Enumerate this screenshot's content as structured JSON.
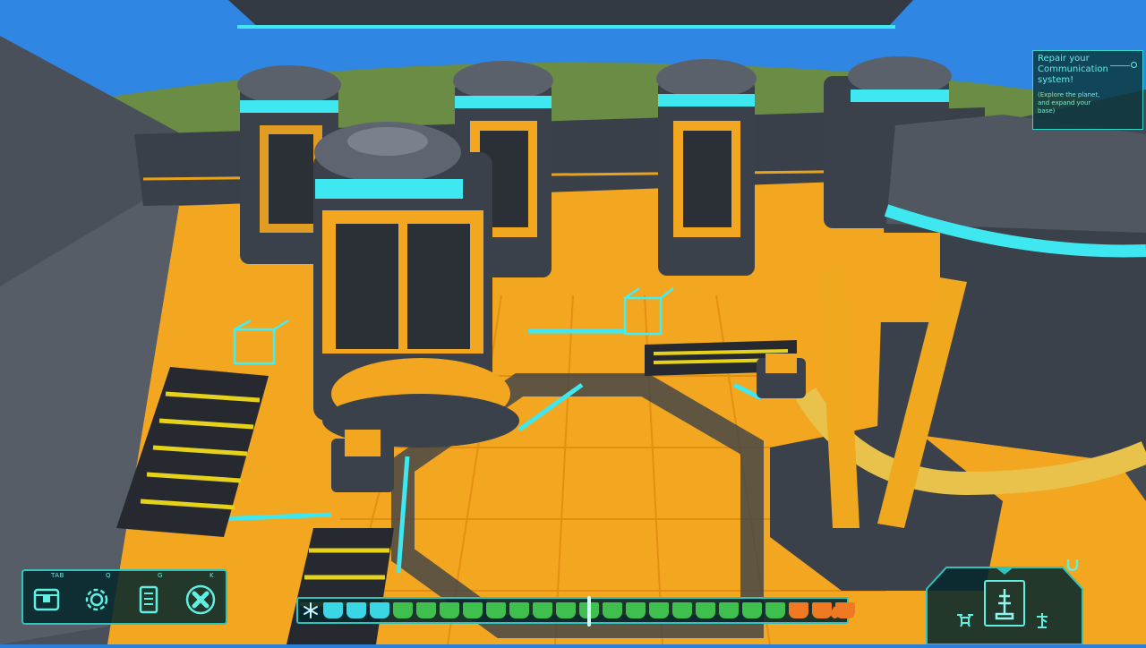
{
  "quest": {
    "title": "Repair your\nCommunication\nsystem!",
    "description": "(Explore the planet,\nand expand your\nbase)"
  },
  "menu": {
    "items": [
      {
        "key": "TAB",
        "icon": "storage-crate-icon"
      },
      {
        "key": "Q",
        "icon": "settings-gear-icon"
      },
      {
        "key": "G",
        "icon": "log-book-icon"
      },
      {
        "key": "K",
        "icon": "close-x-icon"
      }
    ]
  },
  "temperature_bar": {
    "cold_icon": "snowflake-icon",
    "hot_icon": "fire-icon",
    "cells": [
      "cyan",
      "cyan",
      "cyan",
      "green",
      "green",
      "green",
      "green",
      "green",
      "green",
      "green",
      "green",
      "green",
      "green",
      "green",
      "green",
      "green",
      "green",
      "green",
      "green",
      "green",
      "orange",
      "orange",
      "orange"
    ],
    "marker_position": 0.5,
    "colors": {
      "cyan": "#3ad6e6",
      "green": "#3fbf4e",
      "orange": "#f07a22"
    }
  },
  "build_panel": {
    "selected_icon": "antenna-tower-icon",
    "left_icon": "drone-icon",
    "right_icon": "tower-icon",
    "top_icon": "u-shaped-magnet-icon"
  },
  "colors": {
    "hud_teal": "#36d6cc",
    "hud_bg": "#06282e",
    "floor_orange": "#f3a61f",
    "structure_dark": "#3b414a",
    "glow_cyan": "#3fe8f0"
  }
}
